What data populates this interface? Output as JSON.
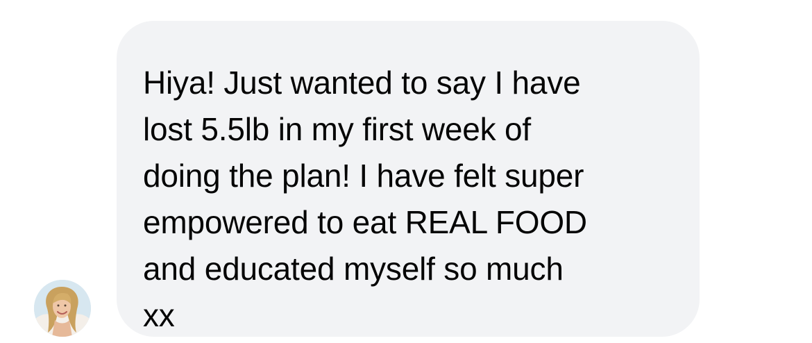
{
  "conversation": {
    "message": {
      "text": "Hiya! Just wanted to say I have\nlost 5.5lb in my first week of\ndoing the plan! I have felt super\nempowered to eat REAL FOOD\nand educated myself so much\nxx"
    },
    "sender": {
      "avatar_icon": "profile-photo"
    }
  },
  "colors": {
    "bubble_background": "#f2f3f5",
    "message_text": "#050505",
    "page_background": "#ffffff"
  }
}
